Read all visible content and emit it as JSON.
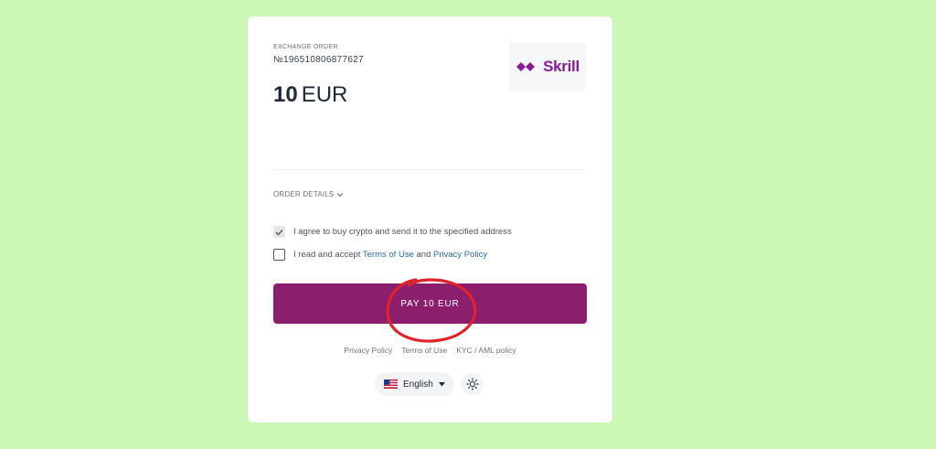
{
  "order": {
    "label": "EXCHANGE ORDER",
    "number": "№196510806877627",
    "amount_value": "10",
    "amount_currency": "EUR"
  },
  "logo": {
    "text": "Skrill",
    "color": "#8a1b96"
  },
  "details": {
    "label": "ORDER DETAILS"
  },
  "agreements": {
    "crypto_label": "I agree to buy crypto and send it to the specified address",
    "crypto_checked": true,
    "terms_prefix": "I read and accept",
    "terms_link": "Terms of Use",
    "terms_and": "and",
    "privacy_link": "Privacy Policy",
    "terms_checked": false
  },
  "pay_button": {
    "label": "PAY 10 EUR",
    "color": "#8b1f6e"
  },
  "footer": {
    "links": [
      "Privacy Policy",
      "Terms of Use",
      "KYC / AML policy"
    ]
  },
  "language": {
    "selected": "English"
  },
  "colors": {
    "background": "#ccf7b5",
    "annotation": "#e0222b"
  }
}
